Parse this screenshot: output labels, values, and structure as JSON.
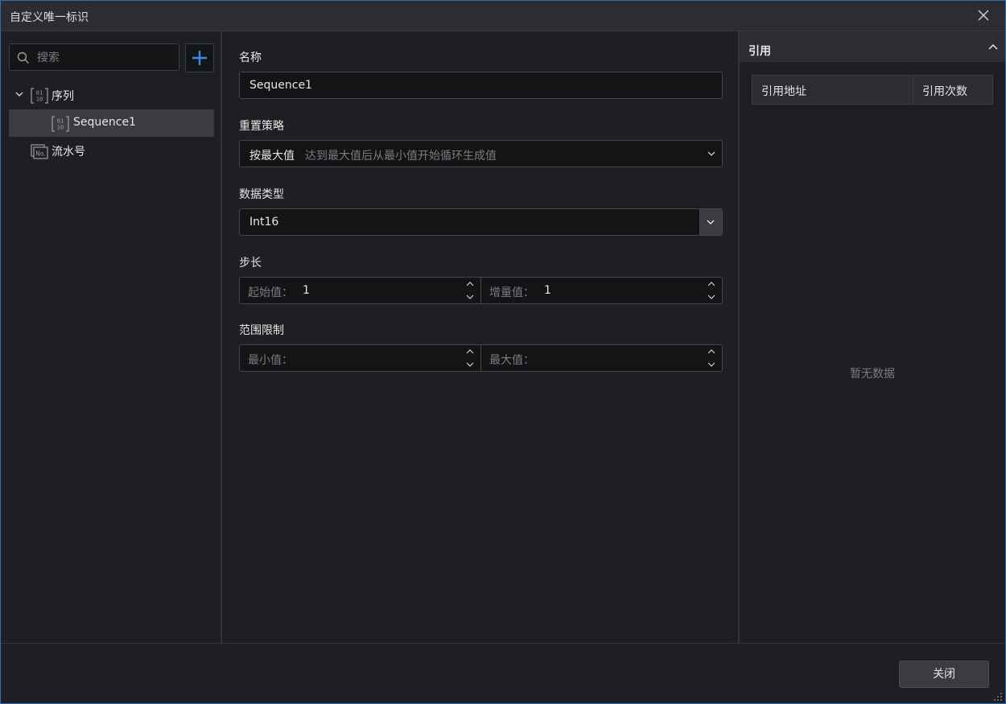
{
  "window": {
    "title": "自定义唯一标识"
  },
  "sidebar": {
    "search_placeholder": "搜索",
    "tree": {
      "group_label": "序列",
      "items": [
        {
          "label": "Sequence1",
          "selected": true
        }
      ],
      "group2_label": "流水号"
    }
  },
  "form": {
    "name_label": "名称",
    "name_value": "Sequence1",
    "reset_label": "重置策略",
    "reset_value": "按最大值",
    "reset_hint": "达到最大值后从最小值开始循环生成值",
    "datatype_label": "数据类型",
    "datatype_value": "Int16",
    "step_label": "步长",
    "start_label": "起始值：",
    "start_value": "1",
    "increment_label": "增量值：",
    "increment_value": "1",
    "range_label": "范围限制",
    "min_label": "最小值：",
    "min_value": "",
    "max_label": "最大值：",
    "max_value": ""
  },
  "references": {
    "title": "引用",
    "columns": [
      "引用地址",
      "引用次数"
    ],
    "empty_text": "暂无数据"
  },
  "footer": {
    "close_label": "关闭"
  },
  "colors": {
    "accent": "#2d6fb3",
    "background": "#1e1f22",
    "panel": "#2b2d30",
    "add_icon": "#3a8ee6"
  }
}
